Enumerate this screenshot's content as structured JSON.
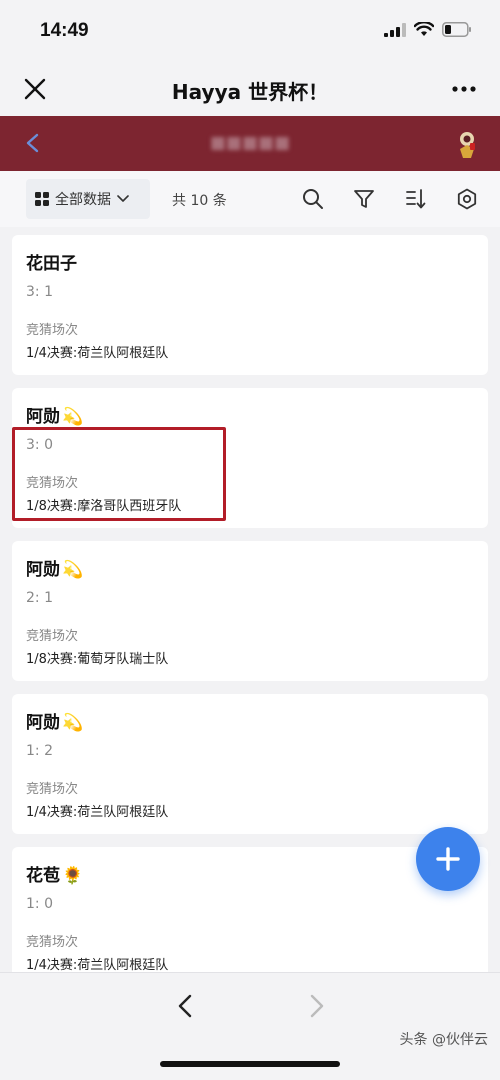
{
  "status_bar": {
    "time": "14:49"
  },
  "nav": {
    "title": "Hayya 世界杯！"
  },
  "toolbar": {
    "view_label": "全部数据",
    "count": "共 10 条"
  },
  "records": [
    {
      "name": "花田子",
      "emoji": "",
      "score": "3: 1",
      "field_label": "竞猜场次",
      "field_value": "1/4决赛:荷兰队阿根廷队"
    },
    {
      "name": "阿勋",
      "emoji": "💫",
      "score": "3: 0",
      "field_label": "竞猜场次",
      "field_value": "1/8决赛:摩洛哥队西班牙队"
    },
    {
      "name": "阿勋",
      "emoji": "💫",
      "score": "2: 1",
      "field_label": "竞猜场次",
      "field_value": "1/8决赛:葡萄牙队瑞士队"
    },
    {
      "name": "阿勋",
      "emoji": "💫",
      "score": "1: 2",
      "field_label": "竞猜场次",
      "field_value": "1/4决赛:荷兰队阿根廷队"
    },
    {
      "name": "花苞",
      "emoji": "🌻",
      "score": "1: 0",
      "field_label": "竞猜场次",
      "field_value": "1/4决赛:荷兰队阿根廷队"
    }
  ],
  "watermark": "头条 @伙伴云",
  "colors": {
    "header": "#7d2530",
    "fab": "#3d82ec",
    "highlight": "#b21d28"
  }
}
